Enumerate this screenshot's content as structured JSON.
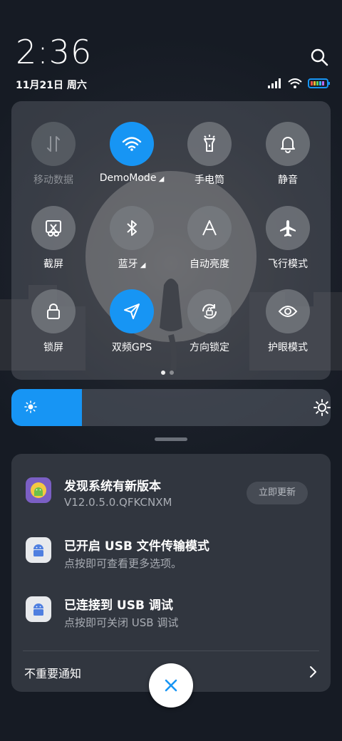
{
  "status": {
    "time": "2:36",
    "date": "11月21日 周六"
  },
  "quick_settings": {
    "tiles": [
      {
        "label": "移动数据",
        "icon": "mobile-data-icon",
        "state": "disabled"
      },
      {
        "label": "DemoMode",
        "icon": "wifi-icon",
        "state": "active",
        "expandable": true
      },
      {
        "label": "手电筒",
        "icon": "flashlight-icon",
        "state": "off"
      },
      {
        "label": "静音",
        "icon": "bell-icon",
        "state": "off"
      },
      {
        "label": "截屏",
        "icon": "screenshot-icon",
        "state": "off"
      },
      {
        "label": "蓝牙",
        "icon": "bluetooth-icon",
        "state": "off",
        "expandable": true
      },
      {
        "label": "自动亮度",
        "icon": "auto-brightness-icon",
        "state": "off"
      },
      {
        "label": "飞行模式",
        "icon": "airplane-icon",
        "state": "off"
      },
      {
        "label": "锁屏",
        "icon": "lock-icon",
        "state": "off"
      },
      {
        "label": "双频GPS",
        "icon": "location-icon",
        "state": "active"
      },
      {
        "label": "方向锁定",
        "icon": "rotation-lock-icon",
        "state": "off"
      },
      {
        "label": "护眼模式",
        "icon": "eye-icon",
        "state": "off"
      }
    ],
    "page_count": 2,
    "current_page": 1
  },
  "brightness": {
    "level": 0.22
  },
  "notifications": [
    {
      "title": "发现系统有新版本",
      "subtitle": "V12.0.5.0.QFKCNXM",
      "action": "立即更新"
    },
    {
      "title": "已开启 USB 文件传输模式",
      "subtitle": "点按即可查看更多选项。"
    },
    {
      "title": "已连接到 USB 调试",
      "subtitle": "点按即可关闭 USB 调试"
    }
  ],
  "unimportant_label": "不重要通知",
  "colors": {
    "accent": "#1795f4",
    "panel": "#31363f"
  }
}
